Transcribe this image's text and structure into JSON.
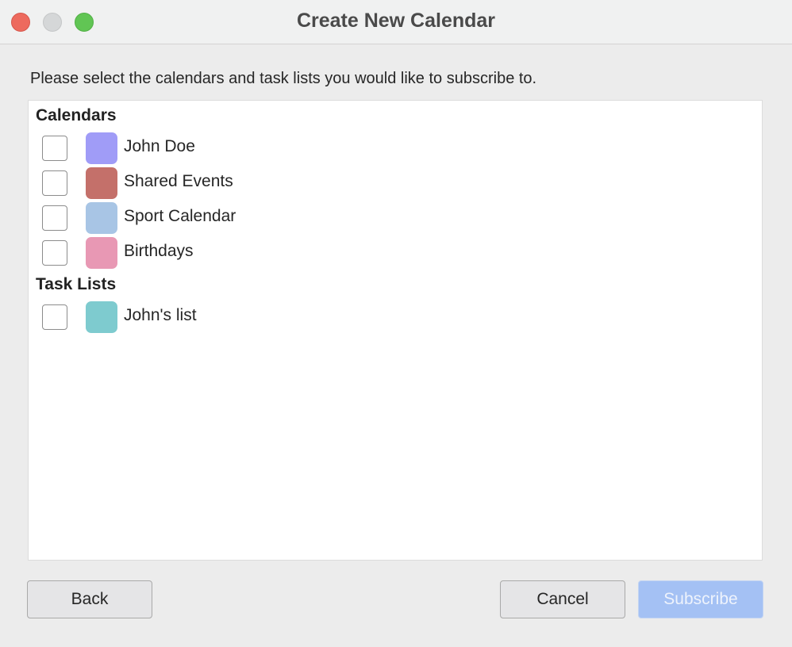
{
  "window": {
    "title": "Create New Calendar"
  },
  "instructions": "Please select the calendars and task lists you would like to subscribe to.",
  "sections": [
    {
      "header": "Calendars",
      "items": [
        {
          "label": "John Doe",
          "color": "#a09cf7",
          "checked": false
        },
        {
          "label": "Shared Events",
          "color": "#c4706a",
          "checked": false
        },
        {
          "label": "Sport Calendar",
          "color": "#a8c5e5",
          "checked": false
        },
        {
          "label": "Birthdays",
          "color": "#e898b4",
          "checked": false
        }
      ]
    },
    {
      "header": "Task Lists",
      "items": [
        {
          "label": "John's list",
          "color": "#7ecbcf",
          "checked": false
        }
      ]
    }
  ],
  "buttons": {
    "back": "Back",
    "cancel": "Cancel",
    "subscribe": "Subscribe"
  },
  "colors": {
    "subscribe_disabled_bg": "#a4c1f4",
    "close": "#ed6a5e",
    "minimize": "#d5d7d8",
    "zoom": "#61c554"
  }
}
